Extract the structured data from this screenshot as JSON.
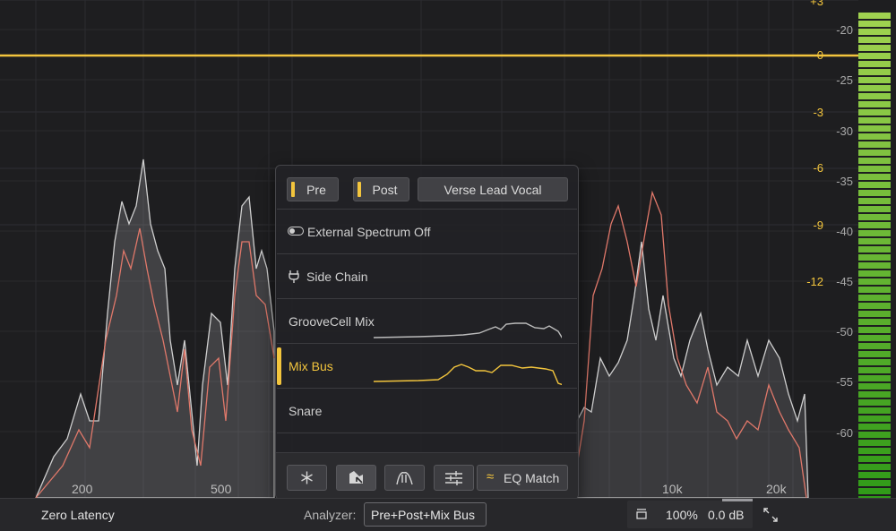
{
  "analyzer": {
    "freq_labels": [
      "200",
      "500",
      "10k",
      "20k"
    ],
    "db_scale_right": [
      "-20",
      "-25",
      "-30",
      "-35",
      "-40",
      "-45",
      "-50",
      "-55",
      "-60"
    ],
    "gain_scale": [
      "+3",
      "0",
      "-3",
      "-6",
      "-9",
      "-12"
    ],
    "colors": {
      "background": "#1c1c1e",
      "eq_line": "#f3c53d",
      "spectrum_white": "#c8c8c8",
      "spectrum_red": "#e0786a"
    }
  },
  "panel": {
    "pre_label": "Pre",
    "post_label": "Post",
    "instance_label": "Verse Lead Vocal",
    "external_label": "External Spectrum Off",
    "sidechain_label": "Side Chain",
    "sources": [
      {
        "label": "GrooveCell Mix",
        "selected": false
      },
      {
        "label": "Mix Bus",
        "selected": true
      },
      {
        "label": "Snare",
        "selected": false
      }
    ],
    "eq_match_label": "EQ Match",
    "tools": [
      "freeze-icon",
      "spectrum-grab-icon",
      "collision-icon",
      "settings-sliders-icon",
      "eq-match-icon"
    ]
  },
  "bottom": {
    "latency": "Zero Latency",
    "analyzer_label": "Analyzer:",
    "analyzer_value": "Pre+Post+Mix Bus",
    "zoom": "100%",
    "gain": "0.0 dB"
  }
}
